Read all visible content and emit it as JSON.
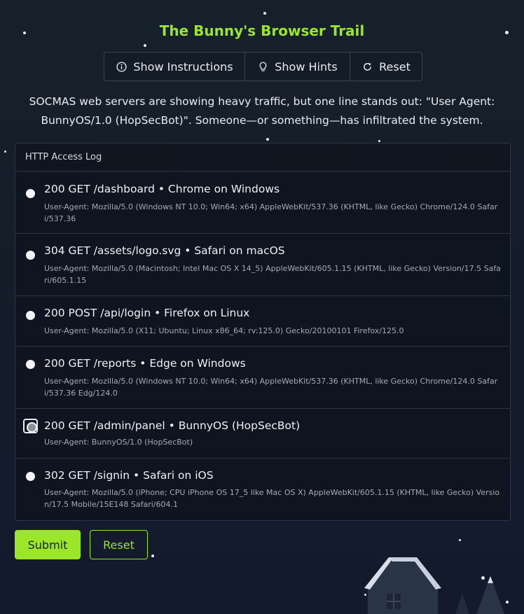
{
  "title": "The Bunny's Browser Trail",
  "toolbar": {
    "instructions_label": "Show Instructions",
    "hints_label": "Show Hints",
    "reset_label": "Reset"
  },
  "intro": "SOCMAS web servers are showing heavy traffic, but one line stands out: \"User Agent: BunnyOS/1.0 (HopSecBot)\". Someone—or something—has infiltrated the system.",
  "log": {
    "header": "HTTP Access Log",
    "entries": [
      {
        "title": "200 GET /dashboard • Chrome on Windows",
        "ua": "User-Agent: Mozilla/5.0 (Windows NT 10.0; Win64; x64) AppleWebKit/537.36 (KHTML, like Gecko) Chrome/124.0 Safari/537.36",
        "selected": false
      },
      {
        "title": "304 GET /assets/logo.svg • Safari on macOS",
        "ua": "User-Agent: Mozilla/5.0 (Macintosh; Intel Mac OS X 14_5) AppleWebKit/605.1.15 (KHTML, like Gecko) Version/17.5 Safari/605.1.15",
        "selected": false
      },
      {
        "title": "200 POST /api/login • Firefox on Linux",
        "ua": "User-Agent: Mozilla/5.0 (X11; Ubuntu; Linux x86_64; rv:125.0) Gecko/20100101 Firefox/125.0",
        "selected": false
      },
      {
        "title": "200 GET /reports • Edge on Windows",
        "ua": "User-Agent: Mozilla/5.0 (Windows NT 10.0; Win64; x64) AppleWebKit/537.36 (KHTML, like Gecko) Chrome/124.0 Safari/537.36 Edg/124.0",
        "selected": false
      },
      {
        "title": "200 GET /admin/panel • BunnyOS (HopSecBot)",
        "ua": "User-Agent: BunnyOS/1.0 (HopSecBot)",
        "selected": true
      },
      {
        "title": "302 GET /signin • Safari on iOS",
        "ua": "User-Agent: Mozilla/5.0 (iPhone; CPU iPhone OS 17_5 like Mac OS X) AppleWebKit/605.1.15 (KHTML, like Gecko) Version/17.5 Mobile/15E148 Safari/604.1",
        "selected": false
      }
    ]
  },
  "actions": {
    "submit_label": "Submit",
    "reset_label": "Reset"
  },
  "colors": {
    "accent": "#9be52a",
    "background": "#16202a"
  }
}
